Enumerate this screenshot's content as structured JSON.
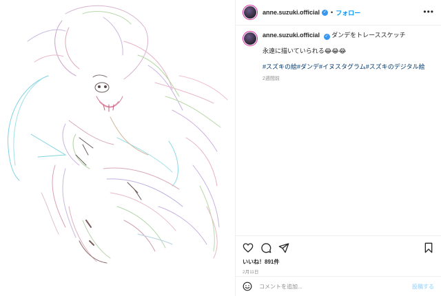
{
  "post": {
    "username": "anne.suzuki.official",
    "follow_label": "フォロー",
    "dot": "•",
    "caption_title": "ダンデをトレーススケッチ",
    "caption_line": "永遠に描いていられる😂😂😂",
    "hashtags": "#スズキの絵#ダンデ#イヌスタグラム#スズキのデジタル絵",
    "time_ago": "2週間前",
    "likes": "いいね！891件",
    "date": "2月11日"
  },
  "comment": {
    "placeholder": "コメントを追加...",
    "post_label": "投稿する"
  },
  "icons": {
    "more": "more-horizontal-icon",
    "verified": "verified-badge-icon",
    "like": "heart-icon",
    "comment": "comment-bubble-icon",
    "share": "paper-plane-icon",
    "save": "bookmark-icon",
    "emoji": "smiley-icon"
  },
  "colors": {
    "accent": "#0095f6",
    "hashtag": "#00376b",
    "muted": "#8e8e8e",
    "post_disabled": "#b2dffc"
  }
}
